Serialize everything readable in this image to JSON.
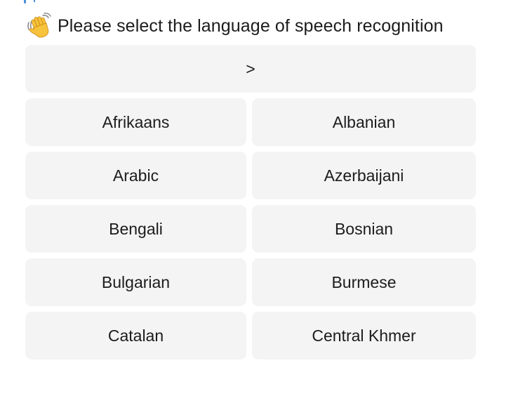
{
  "header": {
    "text": "Please select the language of speech recognition",
    "icon": "waving-hand-icon"
  },
  "keyboard": {
    "next_label": ">",
    "rows": [
      {
        "left": "Afrikaans",
        "right": "Albanian"
      },
      {
        "left": "Arabic",
        "right": "Azerbaijani"
      },
      {
        "left": "Bengali",
        "right": "Bosnian"
      },
      {
        "left": "Bulgarian",
        "right": "Burmese"
      },
      {
        "left": "Catalan",
        "right": "Central Khmer"
      }
    ]
  },
  "colors": {
    "button_bg": "#f4f4f4",
    "text": "#1c1c1e"
  }
}
